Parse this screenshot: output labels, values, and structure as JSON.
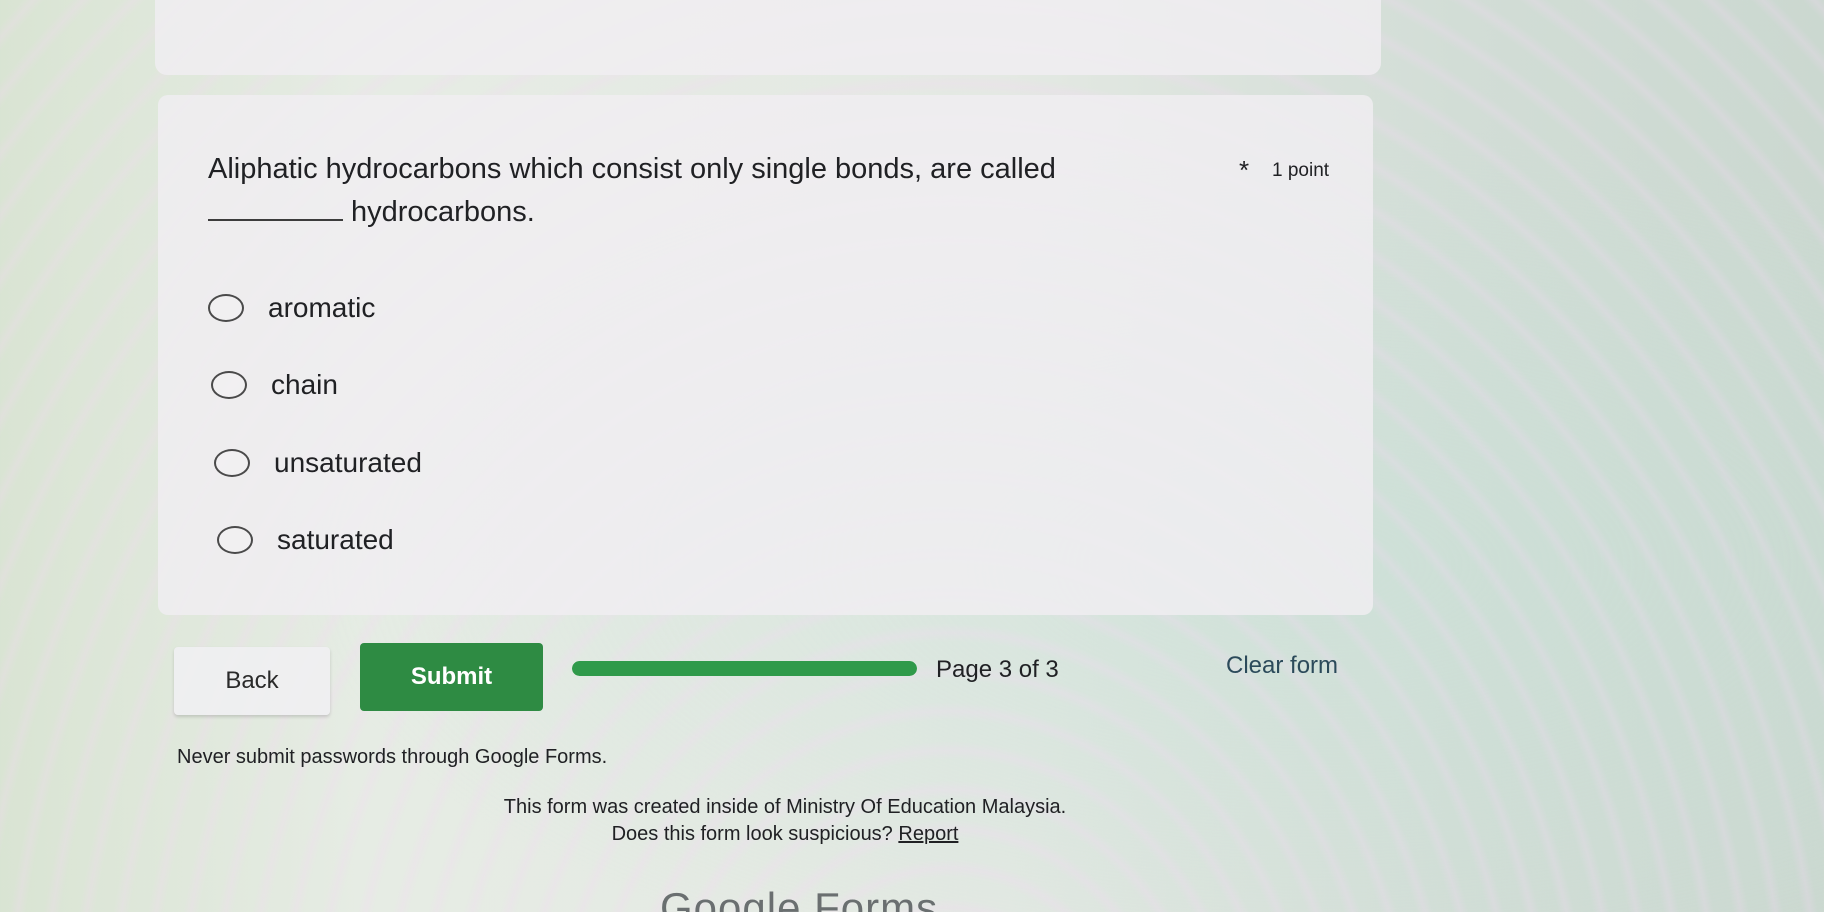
{
  "question": {
    "text": "Aliphatic hydrocarbons which consist only single bonds, are called",
    "continuation": "hydrocarbons.",
    "required_marker": "*",
    "points": "1 point"
  },
  "options": [
    {
      "label": "aromatic"
    },
    {
      "label": "chain"
    },
    {
      "label": "unsaturated"
    },
    {
      "label": "saturated"
    }
  ],
  "navigation": {
    "back_label": "Back",
    "submit_label": "Submit",
    "page_indicator": "Page 3 of 3",
    "progress_fraction": 1.0,
    "clear_label": "Clear form"
  },
  "footer": {
    "warning": "Never submit passwords through Google Forms.",
    "org_note": "This form was created inside of Ministry Of Education Malaysia.",
    "suspicious_text": "Does this form look suspicious?",
    "report_label": "Report",
    "brand": "Google Forms"
  },
  "colors": {
    "submit_green": "#2e8b43",
    "progress_green": "#2f9a4a"
  }
}
